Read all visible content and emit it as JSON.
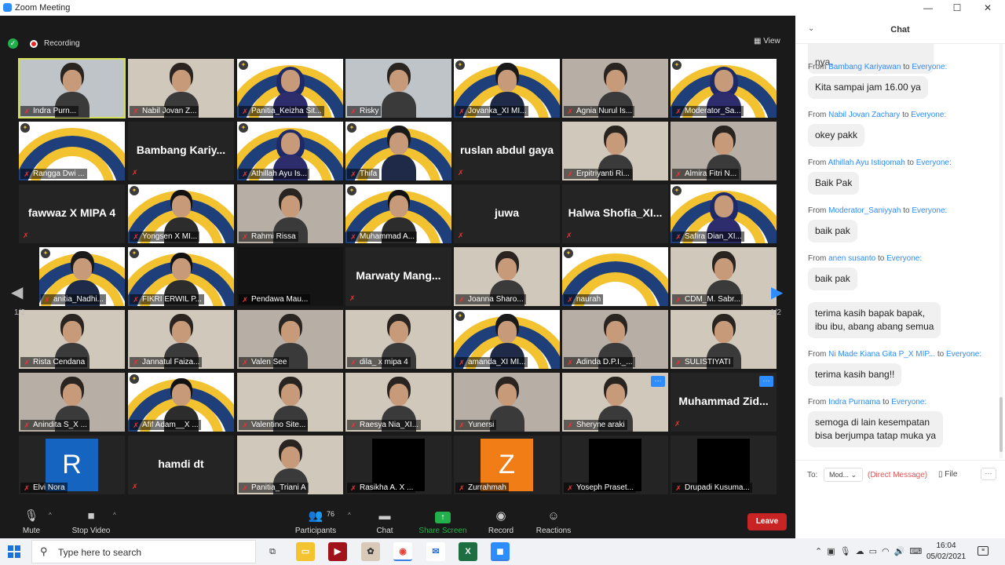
{
  "window": {
    "title": "Zoom Meeting",
    "minimize": "—",
    "maximize": "☐",
    "close": "✕"
  },
  "meeting": {
    "recording_label": "Recording",
    "view_label": "View",
    "page": {
      "prev": "1/2",
      "next": "1/2"
    }
  },
  "tiles": [
    {
      "label": "Indra Purn...",
      "kind": "video",
      "variant": "man",
      "active": true
    },
    {
      "label": "Nabil Jovan Z...",
      "kind": "video",
      "variant": "room"
    },
    {
      "label": "Panitia_Keizha Sit...",
      "kind": "logo",
      "person": "hijab"
    },
    {
      "label": "Risky",
      "kind": "video",
      "variant": "man"
    },
    {
      "label": "Jovanka_XI MI...",
      "kind": "logo",
      "person": "girl"
    },
    {
      "label": "Agnia Nurul Is...",
      "kind": "video",
      "variant": "wall"
    },
    {
      "label": "Moderator_Sa...",
      "kind": "logo",
      "person": "hijab"
    },
    {
      "label": "Rangga Dwi ...",
      "kind": "logo"
    },
    {
      "label": "",
      "kind": "name",
      "name": "Bambang Kariy..."
    },
    {
      "label": "Athillah Ayu Is...",
      "kind": "logo",
      "person": "hijab"
    },
    {
      "label": "Thifa",
      "kind": "logo",
      "person": "girl"
    },
    {
      "label": "",
      "kind": "name",
      "name": "ruslan abdul gaya"
    },
    {
      "label": "Erpitriyanti Ri...",
      "kind": "video",
      "variant": "room"
    },
    {
      "label": "Almira Fitri N...",
      "kind": "video",
      "variant": "wall"
    },
    {
      "label": "",
      "kind": "name",
      "name": "fawwaz X MIPA 4"
    },
    {
      "label": "Yongsen X MI...",
      "kind": "logo",
      "person": "boy"
    },
    {
      "label": "Rahmi Rissa",
      "kind": "video",
      "variant": "wall"
    },
    {
      "label": "Muhammad A...",
      "kind": "logo",
      "person": "boy"
    },
    {
      "label": "",
      "kind": "name",
      "name": "juwa"
    },
    {
      "label": "",
      "kind": "name",
      "name": "Halwa Shofia_XI..."
    },
    {
      "label": "Safira Dian_XI...",
      "kind": "logo",
      "person": "hijab"
    },
    {
      "label": "anitia_Nadhi...",
      "kind": "logo",
      "person": "girl"
    },
    {
      "label": "FIKRI ERWIL P...",
      "kind": "logo",
      "person": "boy"
    },
    {
      "label": "Pendawa Mau...",
      "kind": "dark"
    },
    {
      "label": "",
      "kind": "name",
      "name": "Marwaty Mang..."
    },
    {
      "label": "Joanna Sharo...",
      "kind": "video",
      "variant": "room"
    },
    {
      "label": "naurah",
      "kind": "logo"
    },
    {
      "label": "CDM_M. Sabr...",
      "kind": "video",
      "variant": "room"
    },
    {
      "label": "Rista Cendana",
      "kind": "video",
      "variant": "room"
    },
    {
      "label": "Jannatul Faiza...",
      "kind": "video",
      "variant": "room"
    },
    {
      "label": "Valen See",
      "kind": "video",
      "variant": "wall"
    },
    {
      "label": "dila_ x mipa 4",
      "kind": "video",
      "variant": "room"
    },
    {
      "label": "amanda_XI MI...",
      "kind": "logo",
      "person": "girl"
    },
    {
      "label": "Adinda D.P.I._...",
      "kind": "video",
      "variant": "wall"
    },
    {
      "label": "SULISTIYATI",
      "kind": "video",
      "variant": "room"
    },
    {
      "label": "Anindita S_X ...",
      "kind": "video",
      "variant": "wall"
    },
    {
      "label": "Afif Adam__X ...",
      "kind": "logo",
      "person": "boy"
    },
    {
      "label": "Valentino Site...",
      "kind": "video",
      "variant": "room"
    },
    {
      "label": "Raesya Nia_XI...",
      "kind": "video",
      "variant": "room"
    },
    {
      "label": "Yunersi",
      "kind": "video",
      "variant": "wall"
    },
    {
      "label": "Sheryne araki",
      "kind": "video",
      "variant": "room",
      "more": true
    },
    {
      "label": "",
      "kind": "name",
      "name": "Muhammad Zid...",
      "more": true
    },
    {
      "label": "Elvi Nora",
      "kind": "avatar",
      "letter": "R",
      "color": "#1565c0"
    },
    {
      "label": "",
      "kind": "name",
      "name": "hamdi dt"
    },
    {
      "label": "Panitia_Triani A",
      "kind": "video",
      "variant": "room"
    },
    {
      "label": "Rasikha A. X ...",
      "kind": "black"
    },
    {
      "label": "Zurrahmah",
      "kind": "avatar",
      "letter": "Z",
      "color": "#f07d16"
    },
    {
      "label": "Yoseph Praset...",
      "kind": "black"
    },
    {
      "label": "Drupadi Kusuma...",
      "kind": "black"
    }
  ],
  "toolbar": {
    "mute": "Mute",
    "stop_video": "Stop Video",
    "participants": "Participants",
    "participants_count": "76",
    "chat": "Chat",
    "share_screen": "Share Screen",
    "record": "Record",
    "reactions": "Reactions",
    "leave": "Leave"
  },
  "chat": {
    "title": "Chat",
    "partial_message": "nya.",
    "messages": [
      {
        "from_prefix": "From",
        "sender": "Bambang Kariyawan",
        "to_prefix": "to",
        "recipient": "Everyone:",
        "text": "Kita sampai jam 16.00 ya"
      },
      {
        "from_prefix": "From",
        "sender": "Nabil Jovan Zachary",
        "to_prefix": "to",
        "recipient": "Everyone:",
        "text": "okey pakk"
      },
      {
        "from_prefix": "From",
        "sender": "Athillah Ayu Istiqomah",
        "to_prefix": "to",
        "recipient": "Everyone:",
        "text": "Baik Pak"
      },
      {
        "from_prefix": "From",
        "sender": "Moderator_Saniyyah",
        "to_prefix": "to",
        "recipient": "Everyone:",
        "text": "baik pak"
      },
      {
        "from_prefix": "From",
        "sender": "anen susanto",
        "to_prefix": "to",
        "recipient": "Everyone:",
        "text": "baik pak"
      },
      {
        "from_prefix": "",
        "sender": "",
        "to_prefix": "",
        "recipient": "",
        "text": "terima kasih bapak bapak,\nibu ibu, abang abang semua"
      },
      {
        "from_prefix": "From",
        "sender": "Ni Made Kiana Gita P_X MIP...",
        "to_prefix": "to",
        "recipient": "Everyone:",
        "text": "terima kasih bang!!"
      },
      {
        "from_prefix": "From",
        "sender": "Indra Purnama",
        "to_prefix": "to",
        "recipient": "Everyone:",
        "text": "semoga di lain kesempatan\nbisa berjumpa tatap muka ya"
      }
    ],
    "to_label": "To:",
    "to_value": "Mod...",
    "direct_message": "(Direct Message)",
    "file_label": "File",
    "more_label": "···"
  },
  "taskbar": {
    "search_placeholder": "Type here to search",
    "time": "16:04",
    "date": "05/02/2021"
  }
}
